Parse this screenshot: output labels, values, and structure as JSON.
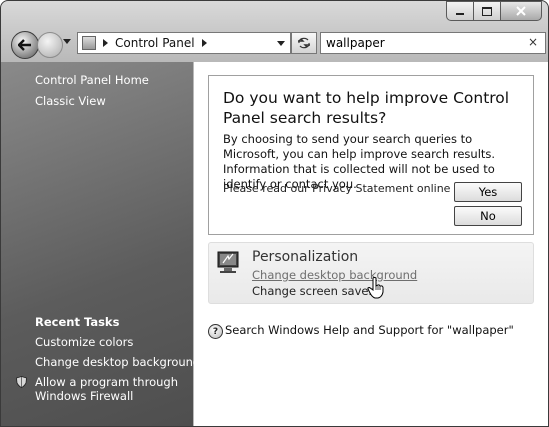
{
  "window": {
    "caption": {
      "minimize_icon": "minimize-icon",
      "maximize_icon": "maximize-icon",
      "close_icon": "close-icon"
    }
  },
  "navbar": {
    "back_icon": "back-arrow-icon",
    "forward_icon": "forward-arrow-icon",
    "address_crumb": "Control Panel",
    "search_value": "wallpaper",
    "refresh_icon": "refresh-icon",
    "clear_icon": "×"
  },
  "sidebar": {
    "top_links": [
      "Control Panel Home",
      "Classic View"
    ],
    "recent_tasks_heading": "Recent Tasks",
    "recent_tasks": [
      "Customize colors",
      "Change desktop background"
    ],
    "firewall_task_line1": "Allow a program through",
    "firewall_task_line2": "Windows Firewall"
  },
  "dialog": {
    "title": "Do you want to help improve Control Panel search results?",
    "body": "By choosing to send your search queries to Microsoft, you can help improve search results. Information that is collected will not be used to identify or contact you.",
    "privacy": "Please read our Privacy Statement online",
    "yes_label": "Yes",
    "no_label": "No"
  },
  "result": {
    "title": "Personalization",
    "link1": "Change desktop background",
    "link2": "Change screen saver"
  },
  "help": {
    "text": "Search Windows Help and Support for \"wallpaper\""
  }
}
